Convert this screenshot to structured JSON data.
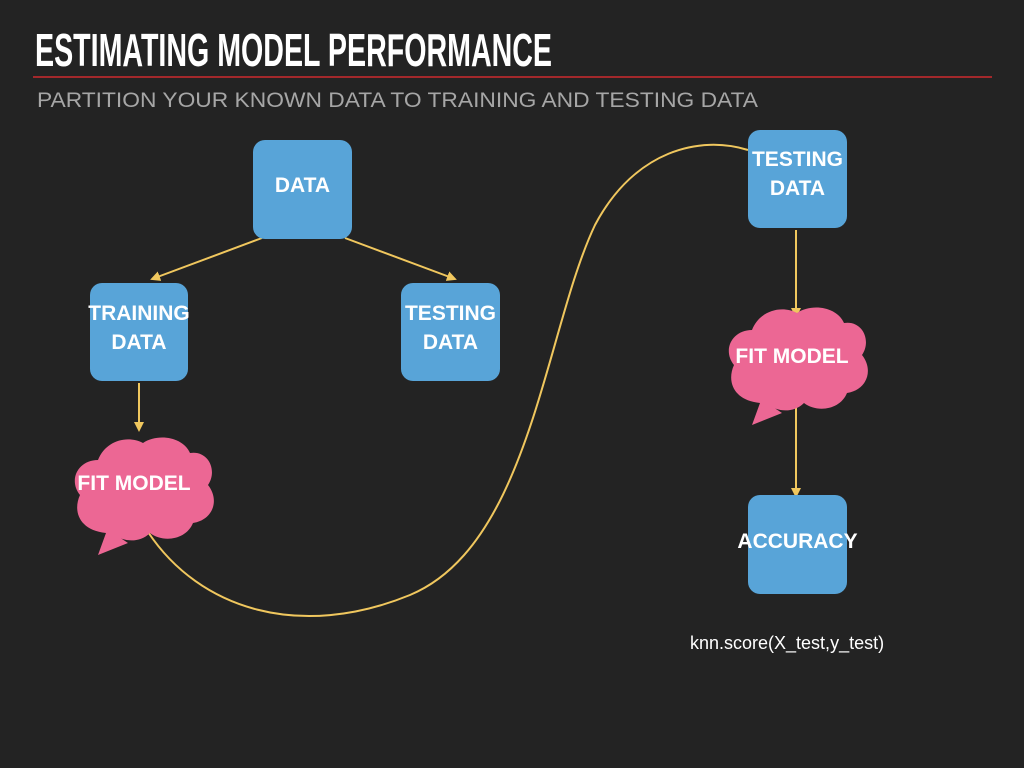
{
  "title": "ESTIMATING MODEL PERFORMANCE",
  "subtitle": "PARTITION YOUR KNOWN DATA TO TRAINING AND TESTING DATA",
  "colors": {
    "box": "#58a4d8",
    "cloud": "#ec6794",
    "arrow": "#f0c75e",
    "rule": "#a3282b",
    "background": "#232323"
  },
  "nodes": {
    "data": [
      "DATA"
    ],
    "training": [
      "TRAINING",
      "DATA"
    ],
    "testing_left": [
      "TESTING",
      "DATA"
    ],
    "fit_left": [
      "FIT MODEL"
    ],
    "testing_right": [
      "TESTING",
      "DATA"
    ],
    "fit_right": [
      "FIT MODEL"
    ],
    "accuracy": [
      "ACCURACY"
    ]
  },
  "code": "knn.score(X_test,y_test)"
}
